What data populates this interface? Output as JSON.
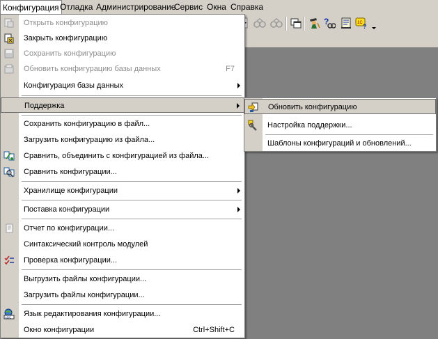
{
  "menubar": {
    "items": [
      {
        "label": "Конфигурация"
      },
      {
        "label": "Отладка"
      },
      {
        "label": "Администрирование"
      },
      {
        "label": "Сервис"
      },
      {
        "label": "Окна"
      },
      {
        "label": "Справка"
      }
    ]
  },
  "toolbar": {
    "icons": [
      "binoculars-icon",
      "binoculars-back-icon",
      "windows-icon",
      "wizard-icon",
      "help-search-icon",
      "notes-icon",
      "help-1c-icon"
    ]
  },
  "config_menu": {
    "items": [
      {
        "label": "Открыть конфигурацию"
      },
      {
        "label": "Закрыть конфигурацию"
      },
      {
        "label": "Сохранить конфигурацию"
      },
      {
        "label": "Обновить конфигурацию базы данных",
        "shortcut": "F7"
      },
      {
        "label": "Конфигурация базы данных"
      },
      {
        "label": "Поддержка"
      },
      {
        "label": "Сохранить конфигурацию в файл..."
      },
      {
        "label": "Загрузить конфигурацию из файла..."
      },
      {
        "label": "Сравнить, объединить с конфигурацией из файла..."
      },
      {
        "label": "Сравнить конфигурации..."
      },
      {
        "label": "Хранилище конфигурации"
      },
      {
        "label": "Поставка конфигурации"
      },
      {
        "label": "Отчет по конфигурации..."
      },
      {
        "label": "Синтаксический контроль модулей"
      },
      {
        "label": "Проверка конфигурации..."
      },
      {
        "label": "Выгрузить файлы конфигурации..."
      },
      {
        "label": "Загрузить файлы конфигурации..."
      },
      {
        "label": "Язык редактирования конфигурации..."
      },
      {
        "label": "Окно конфигурации",
        "shortcut": "Ctrl+Shift+C"
      }
    ]
  },
  "support_submenu": {
    "items": [
      {
        "label": "Обновить конфигурацию"
      },
      {
        "label": "Настройка поддержки..."
      },
      {
        "label": "Шаблоны конфигураций и обновлений..."
      }
    ]
  }
}
